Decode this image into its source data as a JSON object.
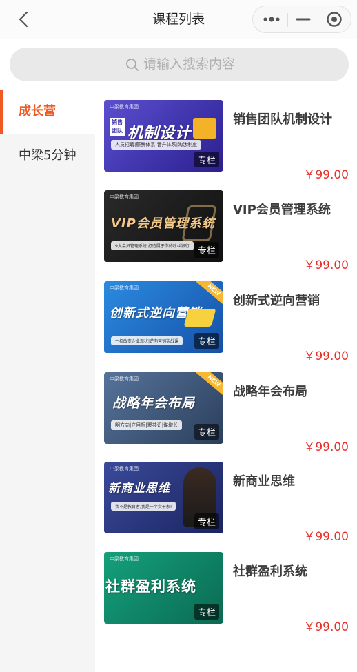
{
  "navbar": {
    "title": "课程列表",
    "icons": [
      "back-icon",
      "more-icon",
      "minimize-icon",
      "close-target-icon"
    ]
  },
  "search": {
    "placeholder": "请输入搜索内容",
    "icon": "search-icon"
  },
  "sidebar": {
    "items": [
      {
        "label": "成长营",
        "active": true
      },
      {
        "label": "中梁5分钟",
        "active": false
      }
    ]
  },
  "courses": [
    {
      "title": "销售团队机制设计",
      "price": "￥99.00",
      "tag": "专栏",
      "thumb_title": "机制设计",
      "thumb_badge": "销售团队",
      "thumb_sub": "人员招聘|薪酬体系|晋升体系|淘汰制度",
      "thumb_bg": "#4a3fb5"
    },
    {
      "title": "VIP会员管理系统",
      "price": "￥99.00",
      "tag": "专栏",
      "thumb_title": "VIP会员管理系统",
      "thumb_sub": "9大会员管理系统,打造属于你的粉丝银行",
      "thumb_bg": "#1e1e1e"
    },
    {
      "title": "创新式逆向营销",
      "price": "￥99.00",
      "tag": "专栏",
      "thumb_title": "创新式逆向营销",
      "thumb_sub": "一招改变企业现状|逆向营销实战课",
      "thumb_bg": "#1d72c9",
      "new": "NEW"
    },
    {
      "title": "战略年会布局",
      "price": "￥99.00",
      "tag": "专栏",
      "thumb_title": "战略年会布局",
      "thumb_sub": "明方向|立目标|聚共识|谋增长",
      "thumb_bg": "#3c5a7e",
      "new": "NEW"
    },
    {
      "title": "新商业思维",
      "price": "￥99.00",
      "tag": "专栏",
      "thumb_title": "新商业思维",
      "thumb_sub": "我不是教育者,我是一个实干家!",
      "thumb_bg": "#2c3a78"
    },
    {
      "title": "社群盈利系统",
      "price": "￥99.00",
      "tag": "专栏",
      "thumb_title": "社群盈利系统",
      "thumb_sub": "",
      "thumb_bg": "#0f8a6a"
    }
  ],
  "thumb_logo": "中梁教育集团",
  "colors": {
    "accent": "#f05a22",
    "price": "#e8302a"
  }
}
